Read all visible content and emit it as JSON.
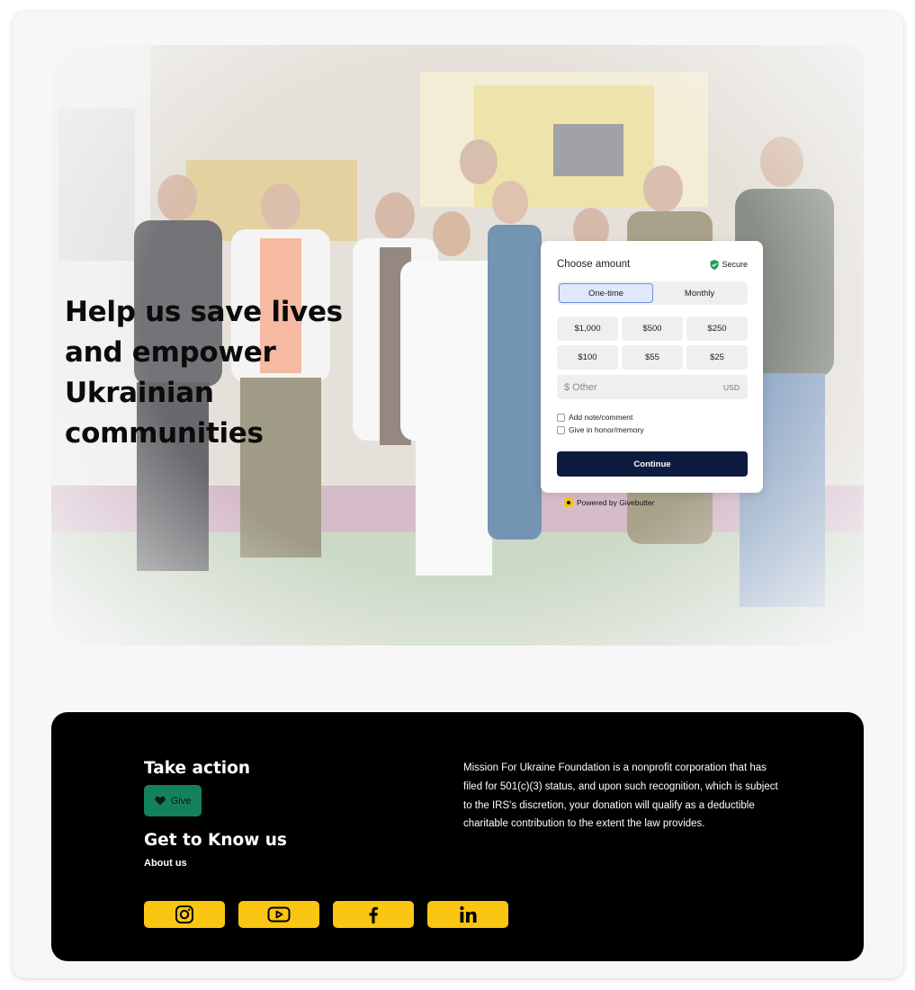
{
  "hero": {
    "title": "Help us save lives and empower Ukrainian communities",
    "photo_icon": "team-photo"
  },
  "donation": {
    "title": "Choose amount",
    "secure_label": "Secure",
    "frequency": [
      {
        "label": "One-time",
        "active": true
      },
      {
        "label": "Monthly",
        "active": false
      }
    ],
    "amounts": [
      "$1,000",
      "$500",
      "$250",
      "$100",
      "$55",
      "$25"
    ],
    "other_placeholder": "$ Other",
    "currency": "USD",
    "options": [
      "Add note/comment",
      "Give in honor/memory"
    ],
    "continue_label": "Continue",
    "powered_by": "Powered by Givebutter"
  },
  "footer": {
    "take_action": "Take action",
    "give_label": "Give",
    "get_to_know": "Get to Know us",
    "about_label": "About us",
    "mission": "Mission For Ukraine Foundation is a nonprofit corporation that has filed for 501(c)(3) status, and upon such recognition, which is subject to the IRS's discretion, your donation will qualify as a deductible charitable contribution to the extent the law provides.",
    "socials": [
      "instagram-icon",
      "youtube-icon",
      "facebook-icon",
      "linkedin-icon"
    ]
  },
  "colors": {
    "accent_yellow": "#fbc513",
    "give_green": "#13825a",
    "continue_navy": "#0d1b3e",
    "footer_bg": "#000000"
  }
}
